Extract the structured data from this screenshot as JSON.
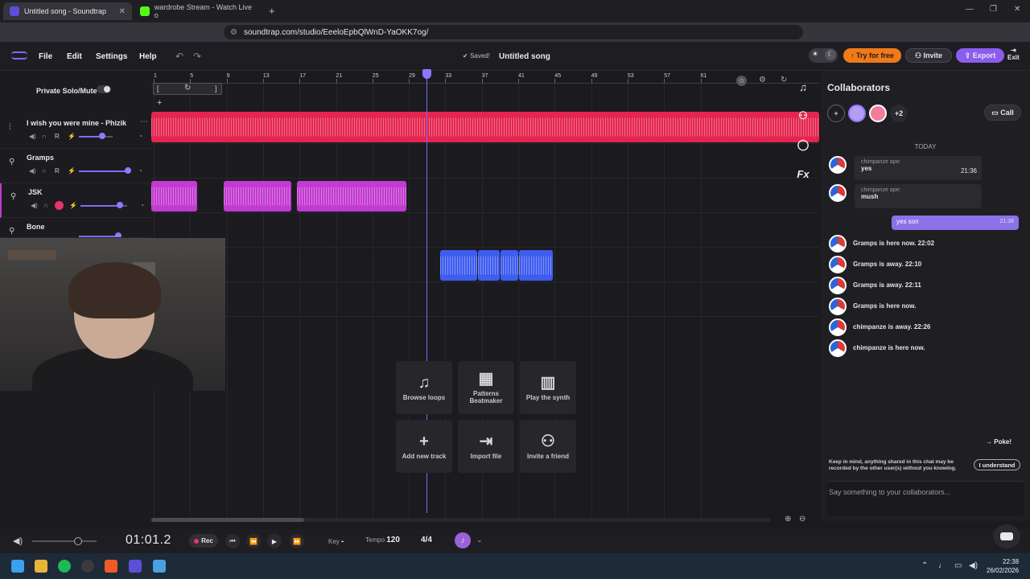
{
  "browser": {
    "tabs": [
      {
        "title": "Untitled song - Soundtrap",
        "favicon_color": "#5b4fd8"
      },
      {
        "title": "wardrobe Stream - Watch Live o",
        "favicon_color": "#53fc18"
      }
    ],
    "url": "soundtrap.com/studio/EeeloEpbQlWnD-YaOKK7og/"
  },
  "header": {
    "menu": [
      "File",
      "Edit",
      "Settings",
      "Help"
    ],
    "saved": "Saved!",
    "song_title": "Untitled song",
    "try_free": "Try for free",
    "invite": "Invite",
    "export": "Export",
    "exit": "Exit"
  },
  "tracks_panel": {
    "private_solo_mute": "Private Solo/Mute",
    "tracks": [
      {
        "name": "I wish you were mine - Phizik",
        "color": "#e4264f",
        "volume": 0.73
      },
      {
        "name": "Gramps",
        "color": "#7d6cf5",
        "volume": 0.95
      },
      {
        "name": "JSK",
        "color": "#c23ad1",
        "volume": 0.83
      },
      {
        "name": "Bone",
        "color": "#3d5cf0",
        "volume": 0.83
      }
    ],
    "rec_button": "R"
  },
  "ruler": {
    "ticks": [
      "1",
      "5",
      "9",
      "13",
      "17",
      "21",
      "25",
      "29",
      "33",
      "37",
      "41",
      "45",
      "49",
      "53",
      "57",
      "61"
    ]
  },
  "tiles": [
    {
      "icon": "♫",
      "label": "Browse loops"
    },
    {
      "icon": "▦",
      "label": "Patterns Beatmaker"
    },
    {
      "icon": "▥",
      "label": "Play the synth"
    },
    {
      "icon": "+",
      "label": "Add new track"
    },
    {
      "icon": "⇥",
      "label": "Import file"
    },
    {
      "icon": "⚇",
      "label": "Invite a friend"
    }
  ],
  "collaborators": {
    "title": "Collaborators",
    "extra_count": "+2",
    "call": "Call",
    "today": "TODAY",
    "messages": [
      {
        "who": "chimpanze ape:",
        "text": "yes",
        "time": "21:36"
      },
      {
        "who": "chimpanze ape:",
        "text": "mush",
        "time": ""
      }
    ],
    "my_message": {
      "text": "yes son",
      "time": "21:38"
    },
    "statuses": [
      "Gramps is here now. 22:02",
      "Gramps is away. 22:10",
      "Gramps is away. 22:11",
      "Gramps is here now.",
      "chimpanze is away. 22:26",
      "chimpanze is here now."
    ],
    "poke": "Poke!",
    "disclaimer": "Keep in mind, anything shared in this chat may be recorded by the other user(s) without you knowing.",
    "understand": "I understand",
    "input_placeholder": "Say something to your collaborators..."
  },
  "transport": {
    "time": "01:01.2",
    "rec": "Rec",
    "key_label": "Key",
    "key_value": "-",
    "tempo_label": "Tempo",
    "tempo_value": "120",
    "time_signature": "4/4"
  },
  "taskbar": {
    "time": "22:38",
    "date": "26/02/2026"
  },
  "colors": {
    "accent": "#7b6af0",
    "try_free": "#f07a1a",
    "export": "#8a5cf0"
  }
}
